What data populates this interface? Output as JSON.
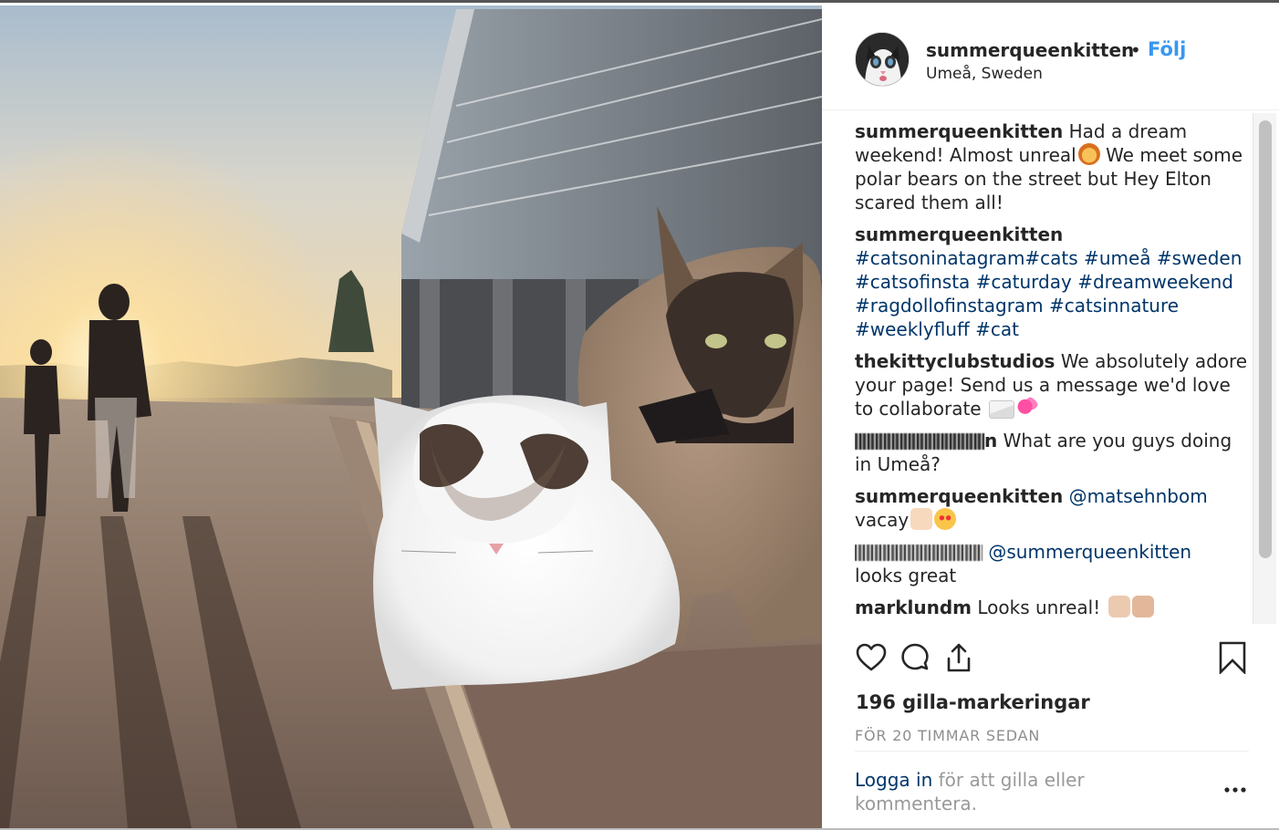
{
  "post": {
    "username": "summerqueenkitten",
    "separator": "•",
    "follow_label": "Följ",
    "location": "Umeå, Sweden"
  },
  "comments": [
    {
      "user": "summerqueenkitten",
      "text_before": "Had a dream weekend! Almost unreal",
      "emoji": "lion-face",
      "text_after": " We meet some polar bears on the street but Hey Elton scared them all!"
    },
    {
      "user": "summerqueenkitten",
      "hashtags": "#catsoninatagram#cats #umeå #sweden #catsofinsta #caturday #dreamweekend #ragdollofinstagram #catsinnature #weeklyfluff #cat"
    },
    {
      "user": "thekittyclubstudios",
      "text": "We absolutely adore your page! Send us a message we'd love to collaborate"
    },
    {
      "user_suffix": "n",
      "text": "What are you guys doing in Umeå?"
    },
    {
      "user": "summerqueenkitten",
      "mention": "@matsehnbom",
      "text": "vacay"
    },
    {
      "mention": "@summerqueenkitten",
      "text": "looks great"
    },
    {
      "user": "marklundm",
      "text": "Looks unreal!"
    }
  ],
  "actions": {
    "like": "heart-icon",
    "comment": "comment-icon",
    "share": "share-icon",
    "save": "bookmark-icon"
  },
  "likes_text": "196 gilla-markeringar",
  "timestamp": "FÖR 20 TIMMAR SEDAN",
  "login": {
    "link": "Logga in",
    "text": " för att gilla eller kommentera."
  },
  "colors": {
    "link_blue": "#003569",
    "follow_blue": "#3897f0",
    "text_dark": "#262626",
    "muted": "#8e8e8e"
  }
}
